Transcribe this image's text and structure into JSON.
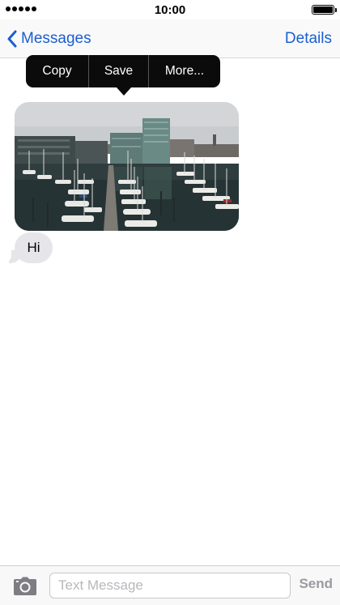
{
  "status_bar": {
    "time": "10:00",
    "signal_bars": 5,
    "battery_level": 1.0
  },
  "nav": {
    "back_label": "Messages",
    "details_label": "Details"
  },
  "context_menu": {
    "items": [
      "Copy",
      "Save",
      "More..."
    ]
  },
  "messages": [
    {
      "type": "photo",
      "icon": "harbor-photo"
    },
    {
      "type": "text",
      "text": "Hi"
    }
  ],
  "composer": {
    "placeholder": "Text Message",
    "value": "",
    "send_label": "Send",
    "camera_icon": "camera-icon"
  },
  "colors": {
    "accent": "#1a5fd1",
    "received_bubble": "#e5e5ea",
    "menu_background": "#0b0b0b",
    "send_disabled": "#9a9aa0"
  }
}
